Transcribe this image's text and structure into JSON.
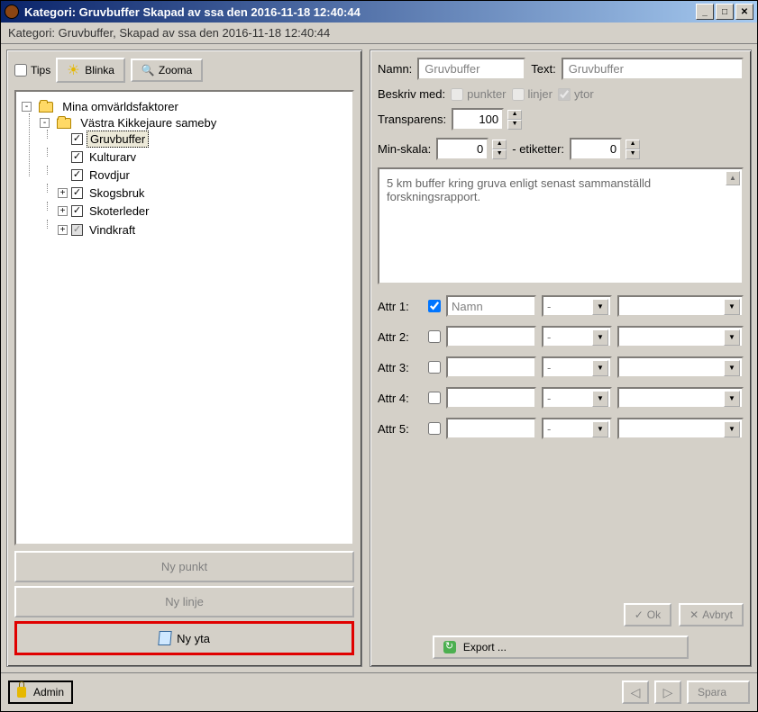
{
  "titlebar": {
    "title": "Kategori: Gruvbuffer Skapad av ssa den 2016-11-18 12:40:44"
  },
  "subtitle": "Kategori: Gruvbuffer, Skapad av ssa den 2016-11-18 12:40:44",
  "toolbar": {
    "tips_label": "Tips",
    "blinka_label": "Blinka",
    "zooma_label": "Zooma"
  },
  "tree": {
    "root": "Mina omvärldsfaktorer",
    "group": "Västra Kikkejaure sameby",
    "items": [
      {
        "label": "Gruvbuffer",
        "checked": true,
        "expandable": false,
        "selected": true
      },
      {
        "label": "Kulturarv",
        "checked": true,
        "expandable": false,
        "selected": false
      },
      {
        "label": "Rovdjur",
        "checked": true,
        "expandable": false,
        "selected": false
      },
      {
        "label": "Skogsbruk",
        "checked": true,
        "expandable": true,
        "selected": false
      },
      {
        "label": "Skoterleder",
        "checked": true,
        "expandable": true,
        "selected": false
      },
      {
        "label": "Vindkraft",
        "checked": "gray",
        "expandable": true,
        "selected": false
      }
    ]
  },
  "bottom_buttons": {
    "ny_punkt": "Ny punkt",
    "ny_linje": "Ny linje",
    "ny_yta": "Ny yta"
  },
  "form": {
    "namn_label": "Namn:",
    "namn_value": "Gruvbuffer",
    "text_label": "Text:",
    "text_value": "Gruvbuffer",
    "beskriv_label": "Beskriv med:",
    "punkter_label": "punkter",
    "linjer_label": "linjer",
    "ytor_label": "ytor",
    "transparens_label": "Transparens:",
    "transparens_value": "100",
    "minskala_label": "Min-skala:",
    "minskala_value": "0",
    "etiketter_label": "- etiketter:",
    "etiketter_value": "0",
    "description": "5 km buffer kring gruva enligt senast sammanställd forskningsrapport."
  },
  "attrs": [
    {
      "label": "Attr 1:",
      "checked": true,
      "name": "Namn",
      "op": "-"
    },
    {
      "label": "Attr 2:",
      "checked": false,
      "name": "",
      "op": "-"
    },
    {
      "label": "Attr 3:",
      "checked": false,
      "name": "",
      "op": "-"
    },
    {
      "label": "Attr 4:",
      "checked": false,
      "name": "",
      "op": "-"
    },
    {
      "label": "Attr 5:",
      "checked": false,
      "name": "",
      "op": "-"
    }
  ],
  "actions": {
    "ok": "Ok",
    "avbryt": "Avbryt",
    "export": "Export ...",
    "admin": "Admin",
    "spara": "Spara"
  }
}
